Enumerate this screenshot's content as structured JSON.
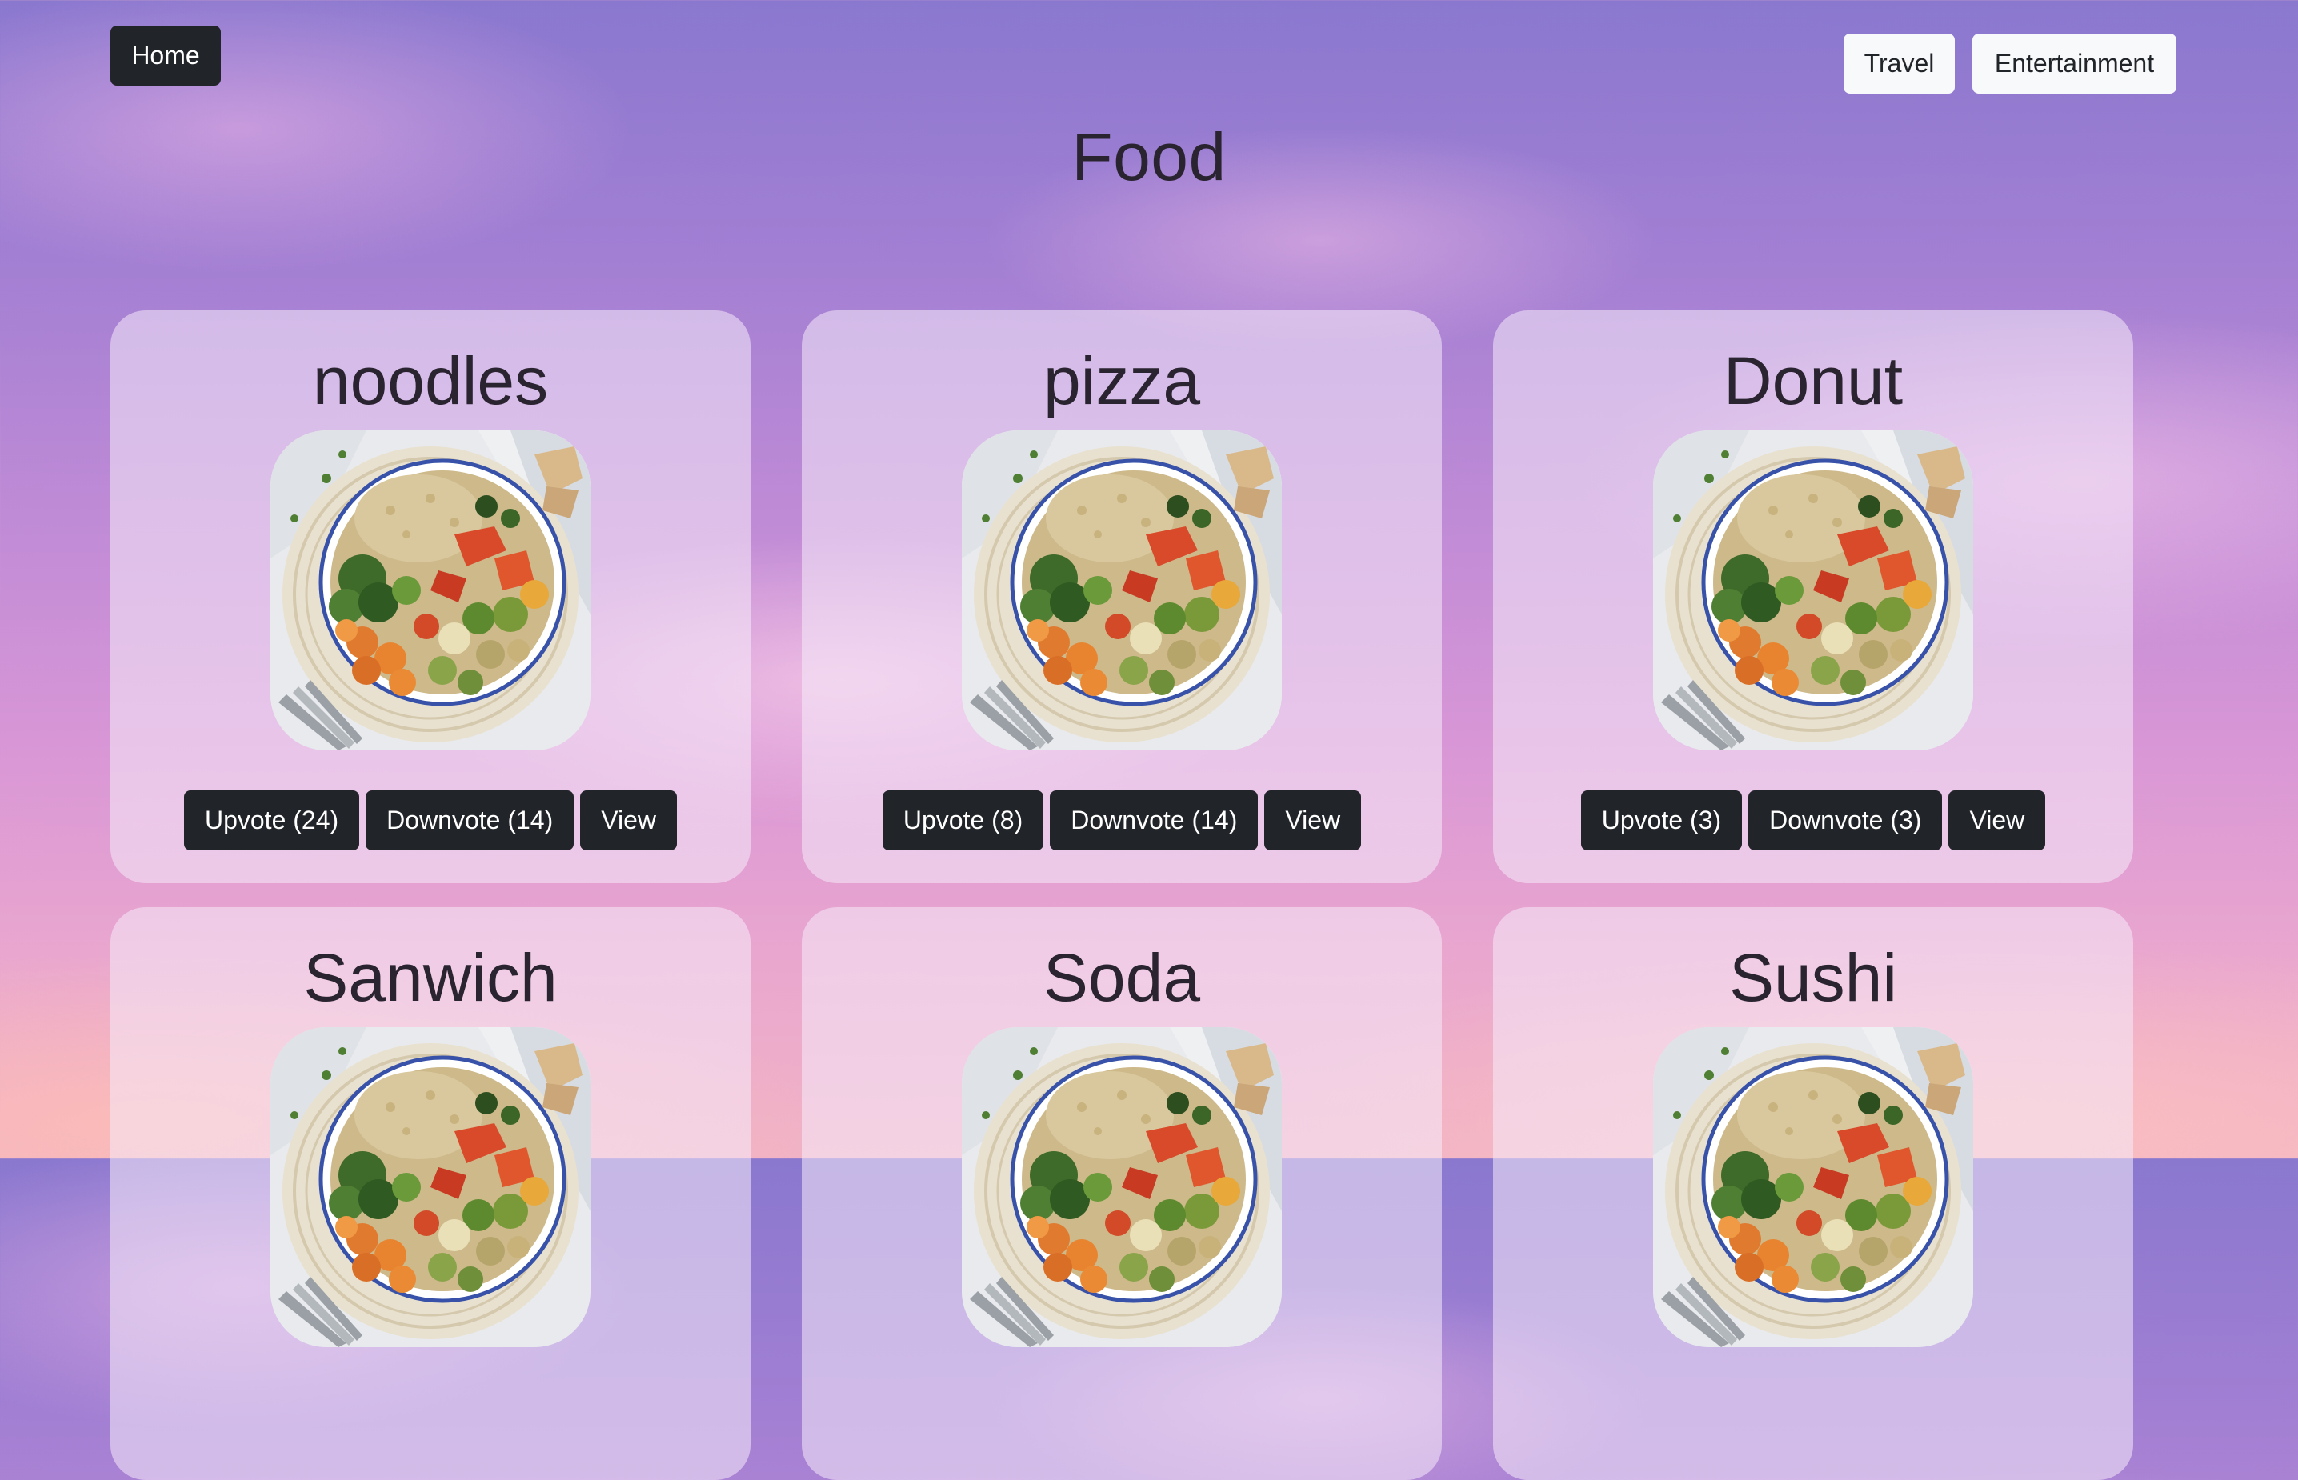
{
  "nav": {
    "home_label": "Home",
    "travel_label": "Travel",
    "entertainment_label": "Entertainment"
  },
  "page": {
    "title": "Food"
  },
  "cards": [
    {
      "title": "noodles",
      "upvote": "Upvote (24)",
      "downvote": "Downvote (14)",
      "view": "View"
    },
    {
      "title": "pizza",
      "upvote": "Upvote (8)",
      "downvote": "Downvote (14)",
      "view": "View"
    },
    {
      "title": "Donut",
      "upvote": "Upvote (3)",
      "downvote": "Downvote (3)",
      "view": "View"
    },
    {
      "title": "Sanwich"
    },
    {
      "title": "Soda"
    },
    {
      "title": "Sushi"
    }
  ],
  "colors": {
    "button_dark": "#212529",
    "button_light": "#f8f9fa",
    "card_bg": "rgba(245,235,250,0.55)"
  }
}
